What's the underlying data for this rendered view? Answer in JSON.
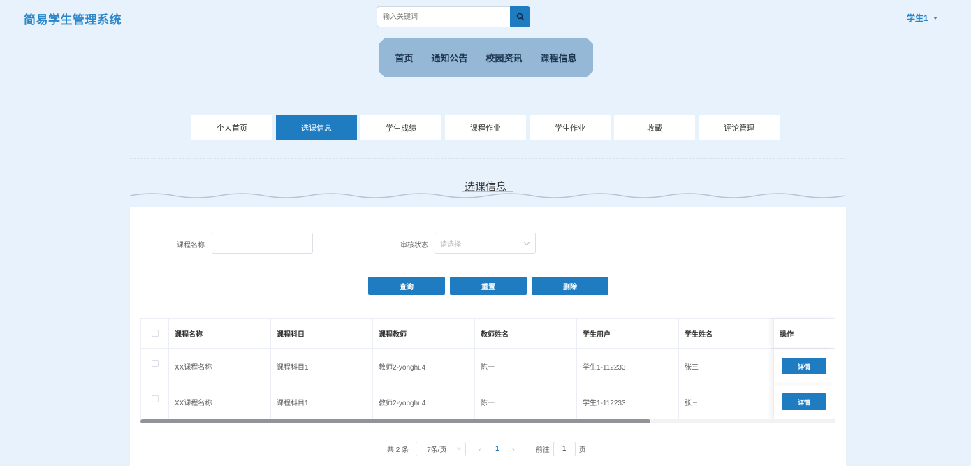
{
  "header": {
    "brand": "简易学生管理系统",
    "search_placeholder": "输入关键词",
    "user": "学生1"
  },
  "main_nav": [
    "首页",
    "通知公告",
    "校园资讯",
    "课程信息"
  ],
  "tabs": [
    "个人首页",
    "选课信息",
    "学生成绩",
    "课程作业",
    "学生作业",
    "收藏",
    "评论管理"
  ],
  "active_tab": "选课信息",
  "section_title": "选课信息",
  "filters": {
    "course_name_label": "课程名称",
    "course_name_value": "",
    "review_status_label": "审核状态",
    "review_status_placeholder": "请选择"
  },
  "buttons": {
    "query": "查询",
    "reset": "重置",
    "delete": "删除"
  },
  "table": {
    "columns": [
      "课程名称",
      "课程科目",
      "课程教师",
      "教师姓名",
      "学生用户",
      "学生姓名",
      "操作"
    ],
    "rows": [
      [
        "XX课程名称",
        "课程科目1",
        "教师2-yonghu4",
        "陈一",
        "学生1-112233",
        "张三"
      ],
      [
        "XX课程名称",
        "课程科目1",
        "教师2-yonghu4",
        "陈一",
        "学生1-112233",
        "张三"
      ]
    ],
    "detail_label": "详情"
  },
  "pagination": {
    "total": "共 2 条",
    "page_size": "7条/页",
    "prev": "‹",
    "current": "1",
    "next": "›",
    "goto_label": "前往",
    "goto_value": "1",
    "page_suffix": "页"
  },
  "colors": {
    "primary": "#1f7cc0",
    "background": "#e8f2fc",
    "nav_bg": "#94b8d6"
  }
}
